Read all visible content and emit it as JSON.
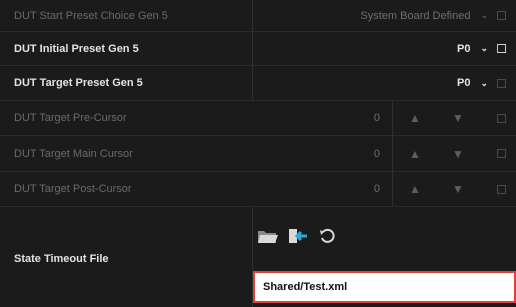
{
  "rows": [
    {
      "label": "DUT Start Preset Choice Gen 5",
      "value": "System Board Defined",
      "state": "disabled"
    },
    {
      "label": "DUT Initial Preset Gen 5",
      "value": "P0",
      "state": "enabled"
    },
    {
      "label": "DUT Target Preset Gen 5",
      "value": "P0",
      "state": "enabled"
    },
    {
      "label": "DUT Target Pre-Cursor",
      "value": "0",
      "state": "disabled"
    },
    {
      "label": "DUT Target Main Cursor",
      "value": "0",
      "state": "disabled"
    },
    {
      "label": "DUT Target Post-Cursor",
      "value": "0",
      "state": "disabled"
    }
  ],
  "state_timeout": {
    "label": "State Timeout File",
    "file_path": "Shared/Test.xml"
  },
  "icons": {
    "chevron": "chevron-down-icon",
    "up": "triangle-up-icon",
    "down": "triangle-down-icon",
    "open": "folder-open-icon",
    "import": "import-arrow-icon",
    "reset": "reset-icon"
  },
  "colors": {
    "background": "#1b1b1b",
    "highlight_border": "#e04040",
    "icon_accent": "#2aa8e0"
  }
}
